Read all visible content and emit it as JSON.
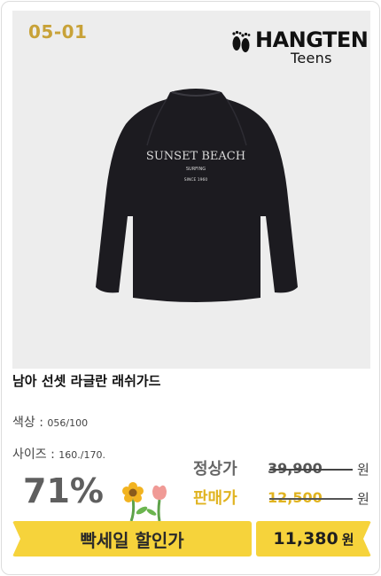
{
  "product": {
    "code": "05-01",
    "brand": "HANGTEN",
    "brand_sub": "Teens",
    "print_line1": "SUNSET BEACH",
    "print_line2": "SURFING",
    "print_line3": "SINCE 1960",
    "title": "남아 선셋 라글란 래쉬가드",
    "color_label": "색상 :",
    "color_value": "056/100",
    "size_label": "사이즈 :",
    "size_value": "160./170."
  },
  "pricing": {
    "discount": "71%",
    "regular_label": "정상가",
    "regular_price": "39,900",
    "sale_label": "판매가",
    "sale_price": "12,500",
    "currency": "원",
    "promo_label": "빡세일 할인가",
    "promo_price": "11,380",
    "promo_currency": "원"
  },
  "colors": {
    "accent": "#f6d33b",
    "code_gold": "#c8a238"
  }
}
